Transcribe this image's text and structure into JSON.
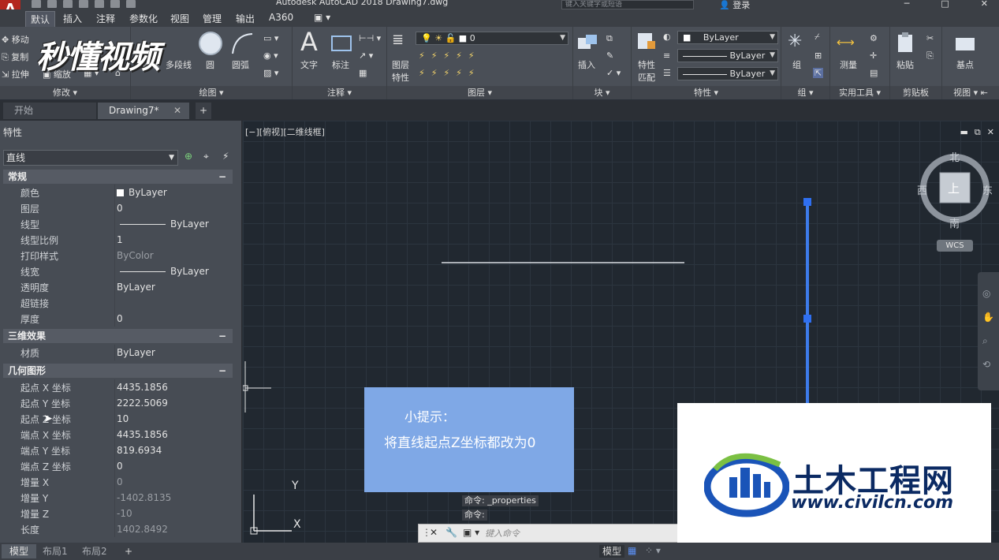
{
  "window": {
    "title": "Autodesk AutoCAD 2018    Drawing7.dwg",
    "search_placeholder": "键入关键字或短语",
    "login": "登录"
  },
  "ribbon_tabs": [
    "默认",
    "插入",
    "注释",
    "参数化",
    "视图",
    "管理",
    "输出",
    "A360"
  ],
  "overlay_logo": "秒懂视频",
  "ribbon": {
    "modify": {
      "title": "修改",
      "move": "移动",
      "copy": "复制",
      "stretch": "拉伸",
      "scale": "缩放"
    },
    "draw": {
      "title": "绘图",
      "line": "直线",
      "polyline": "多段线",
      "circle": "圆",
      "arc": "圆弧"
    },
    "annotation": {
      "title": "注释",
      "text": "文字",
      "dim": "标注"
    },
    "layers": {
      "title": "图层",
      "props_label_1": "图层",
      "props_label_2": "特性",
      "layer_value": "0"
    },
    "block": {
      "title": "块",
      "insert": "插入"
    },
    "properties": {
      "title": "特性",
      "match_1": "特性",
      "match_2": "匹配",
      "color": "ByLayer",
      "linetype": "ByLayer",
      "lineweight": "ByLayer"
    },
    "groups": {
      "title": "组",
      "group": "组"
    },
    "utilities": {
      "title": "实用工具",
      "measure": "测量"
    },
    "clipboard": {
      "title": "剪贴板",
      "paste": "粘贴"
    },
    "view": {
      "title": "视图",
      "base": "基点"
    }
  },
  "file_tabs": {
    "start": "开始",
    "drawing": "Drawing7*",
    "close": "✕",
    "add": "+"
  },
  "properties_palette": {
    "title": "特性",
    "object_type": "直线",
    "sections": {
      "general": {
        "title": "常规",
        "rows": [
          {
            "key": "颜色",
            "value": "ByLayer"
          },
          {
            "key": "图层",
            "value": "0"
          },
          {
            "key": "线型",
            "value": "ByLayer"
          },
          {
            "key": "线型比例",
            "value": "1"
          },
          {
            "key": "打印样式",
            "value": "ByColor"
          },
          {
            "key": "线宽",
            "value": "ByLayer"
          },
          {
            "key": "透明度",
            "value": "ByLayer"
          },
          {
            "key": "超链接",
            "value": ""
          },
          {
            "key": "厚度",
            "value": "0"
          }
        ]
      },
      "3d": {
        "title": "三维效果",
        "rows": [
          {
            "key": "材质",
            "value": "ByLayer"
          }
        ]
      },
      "geometry": {
        "title": "几何图形",
        "rows": [
          {
            "key": "起点 X 坐标",
            "value": "4435.1856"
          },
          {
            "key": "起点 Y 坐标",
            "value": "2222.5069"
          },
          {
            "key": "起点 Z 坐标",
            "value": "10"
          },
          {
            "key": "端点 X 坐标",
            "value": "4435.1856"
          },
          {
            "key": "端点 Y 坐标",
            "value": "819.6934"
          },
          {
            "key": "端点 Z 坐标",
            "value": "0"
          },
          {
            "key": "增量 X",
            "value": "0"
          },
          {
            "key": "增量 Y",
            "value": "-1402.8135"
          },
          {
            "key": "增量 Z",
            "value": "-10"
          },
          {
            "key": "长度",
            "value": "1402.8492"
          }
        ]
      }
    }
  },
  "viewport": {
    "label": "[−][俯视][二维线框]",
    "viewcube": {
      "north": "北",
      "south": "南",
      "east": "东",
      "west": "西",
      "top": "上",
      "wcs": "WCS"
    },
    "ucs_x": "X",
    "ucs_y": "Y"
  },
  "tip": {
    "title": "小提示：",
    "body": "将直线起点Z坐标都改为0"
  },
  "command": {
    "history_1": "命令: _properties",
    "history_2": "命令:",
    "placeholder": "键入命令"
  },
  "watermark": {
    "cn": "土木工程网",
    "url": "www.civilcn.com"
  },
  "status_tabs": {
    "model": "模型",
    "layout1": "布局1",
    "layout2": "布局2",
    "add": "+"
  },
  "status": {
    "model": "模型"
  }
}
